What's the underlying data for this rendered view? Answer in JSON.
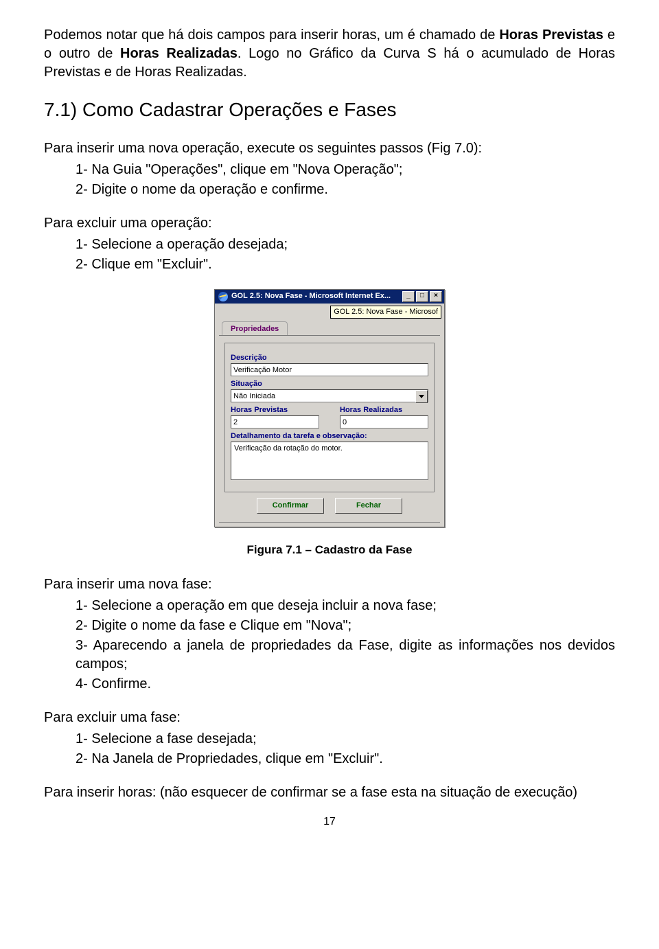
{
  "para1_pre": "Podemos notar que há dois campos para inserir horas, um é chamado de ",
  "para1_b1": "Horas Previstas",
  "para1_mid": " e o outro de ",
  "para1_b2": "Horas Realizadas",
  "para1_post": ". Logo no Gráfico da Curva S há o acumulado de Horas Previstas e de Horas Realizadas.",
  "heading": "7.1) Como Cadastrar Operações e Fases",
  "para2": "Para inserir uma nova operação, execute os seguintes passos (Fig 7.0):",
  "list1": {
    "i1": "1-  Na Guia \"Operações\", clique em \"Nova Operação\";",
    "i2": "2-  Digite o nome da operação e confirme."
  },
  "para3": "Para excluir uma operação:",
  "list2": {
    "i1": "1-  Selecione a operação desejada;",
    "i2": "2-  Clique em \"Excluir\"."
  },
  "dialog": {
    "title": "GOL 2.5: Nova Fase - Microsoft Internet Ex...",
    "tooltip": "GOL 2.5: Nova Fase - Microsof",
    "tab": "Propriedades",
    "labels": {
      "descricao": "Descrição",
      "situacao": "Situação",
      "horas_prev": "Horas Previstas",
      "horas_real": "Horas Realizadas",
      "detalhamento": "Detalhamento da tarefa e observação:"
    },
    "values": {
      "descricao": "Verificação Motor",
      "situacao": "Não Iniciada",
      "horas_prev": "2",
      "horas_real": "0",
      "detalhamento": "Verificação da rotação do motor."
    },
    "buttons": {
      "confirmar": "Confirmar",
      "fechar": "Fechar"
    }
  },
  "caption": "Figura 7.1 – Cadastro da Fase",
  "para4": "Para inserir uma nova fase:",
  "list3": {
    "i1": "1-  Selecione a operação em que deseja incluir a nova fase;",
    "i2": "2-  Digite o nome da fase e Clique em \"Nova\";",
    "i3": "3-  Aparecendo a janela de propriedades da Fase, digite as informações nos devidos campos;",
    "i4": "4-  Confirme."
  },
  "para5": "Para excluir uma fase:",
  "list4": {
    "i1": "1-  Selecione a fase desejada;",
    "i2": "2-  Na Janela de Propriedades, clique em \"Excluir\"."
  },
  "para6": "Para inserir horas: (não esquecer de confirmar se a fase esta na situação de execução)",
  "page_number": "17"
}
